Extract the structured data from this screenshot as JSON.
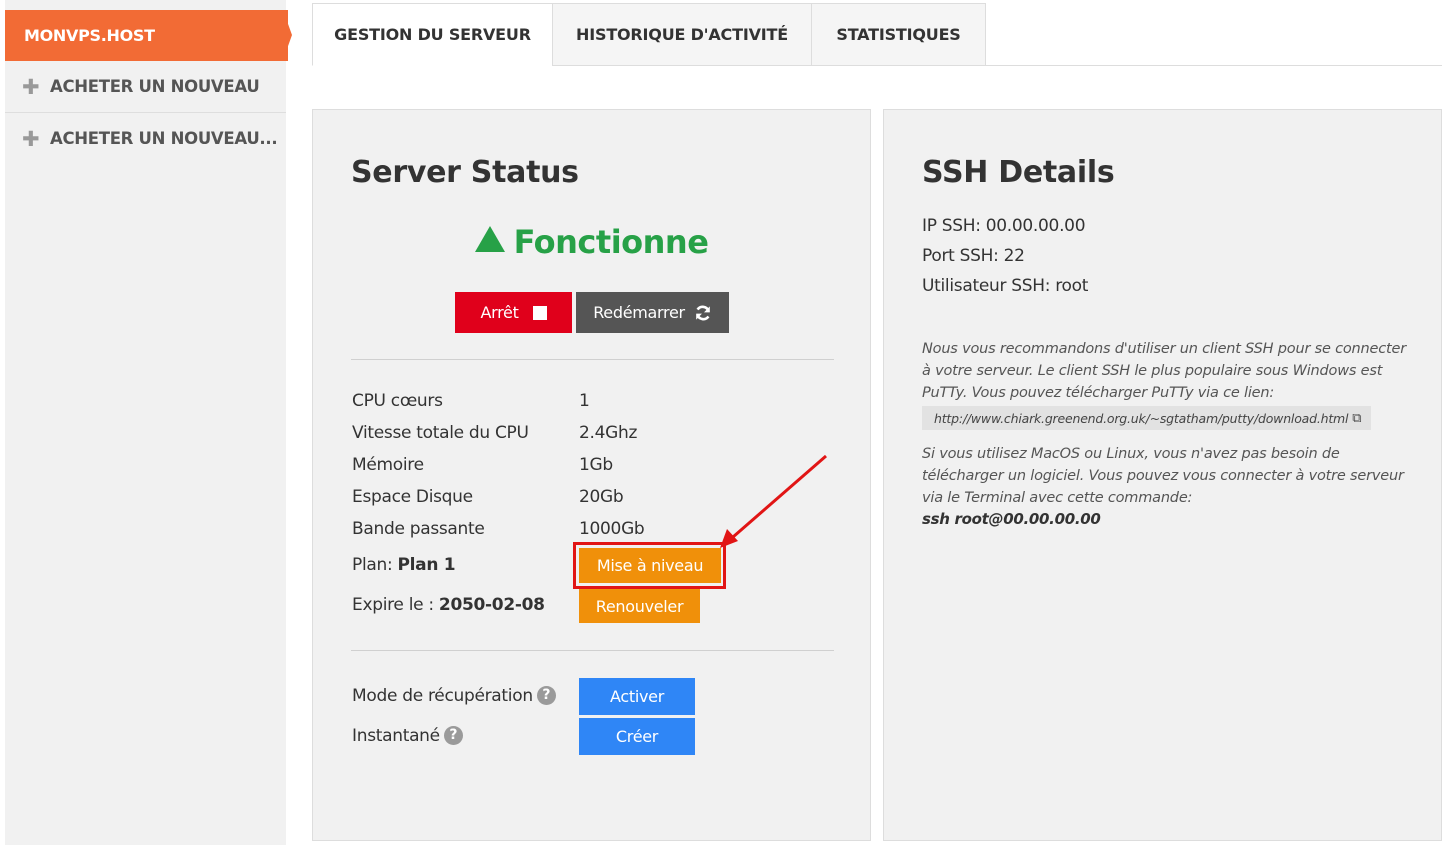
{
  "sidebar": {
    "brand": "MONVPS.HOST",
    "items": [
      {
        "icon": "plus-icon",
        "label": "ACHETER UN NOUVEAU"
      },
      {
        "icon": "plus-icon",
        "label": "ACHETER UN NOUVEAU..."
      }
    ]
  },
  "tabs": [
    {
      "label": "GESTION DU SERVEUR",
      "active": true
    },
    {
      "label": "HISTORIQUE D'ACTIVITÉ",
      "active": false
    },
    {
      "label": "STATISTIQUES",
      "active": false
    }
  ],
  "server_status": {
    "title": "Server Status",
    "status_icon": "triangle-up-icon",
    "status_text": "Fonctionne",
    "stop_label": "Arrêt",
    "stop_icon": "stop-square-icon",
    "restart_label": "Redémarrer",
    "restart_icon": "refresh-icon",
    "specs": [
      {
        "label": "CPU cœurs",
        "value": "1"
      },
      {
        "label": "Vitesse totale du CPU",
        "value": "2.4Ghz"
      },
      {
        "label": "Mémoire",
        "value": "1Gb"
      },
      {
        "label": "Espace Disque",
        "value": "20Gb"
      },
      {
        "label": "Bande passante",
        "value": "1000Gb"
      }
    ],
    "plan_label": "Plan: ",
    "plan_value": "Plan 1",
    "upgrade_label": "Mise à niveau",
    "expire_label": "Expire le : ",
    "expire_value": "2050-02-08",
    "renew_label": "Renouveler",
    "recovery_label": "Mode de récupération",
    "recovery_button": "Activer",
    "snapshot_label": "Instantané",
    "snapshot_button": "Créer",
    "help_glyph": "?"
  },
  "ssh": {
    "title": "SSH Details",
    "ip_line": "IP SSH: 00.00.00.00",
    "port_line": "Port SSH: 22",
    "user_line": "Utilisateur SSH: root",
    "note_windows": "Nous vous recommandons d'utiliser un client SSH pour se connecter à votre serveur. Le client SSH le plus populaire sous Windows est PuTTy. Vous pouvez télécharger PuTTy via ce lien:",
    "putty_link": "http://www.chiark.greenend.org.uk/~sgtatham/putty/download.html",
    "link_icon": "external-link-icon",
    "note_unix": "Si vous utilisez MacOS ou Linux, vous n'avez pas besoin de télécharger un logiciel. Vous pouvez vous connecter à votre serveur via le Terminal avec cette commande:",
    "command": "ssh root@00.00.00.00"
  },
  "colors": {
    "brand": "#f26b35",
    "status_green": "#27a147",
    "stop_red": "#e0001b",
    "restart_gray": "#555555",
    "orange": "#f0900a",
    "blue": "#2f86f6",
    "annotation_red": "#e11515"
  }
}
